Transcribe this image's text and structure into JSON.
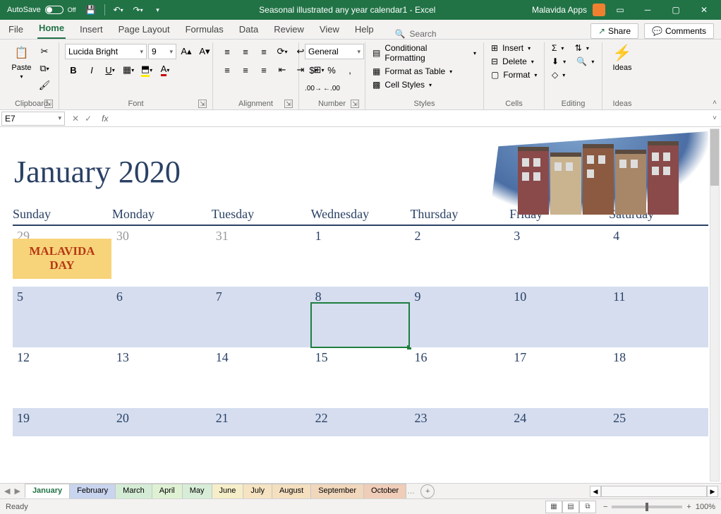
{
  "titlebar": {
    "autosave_label": "AutoSave",
    "autosave_state": "Off",
    "title": "Seasonal illustrated any year calendar1 - Excel",
    "apps_label": "Malavida Apps"
  },
  "tabs": {
    "file": "File",
    "home": "Home",
    "insert": "Insert",
    "pagelayout": "Page Layout",
    "formulas": "Formulas",
    "data": "Data",
    "review": "Review",
    "view": "View",
    "help": "Help",
    "search": "Search",
    "share": "Share",
    "comments": "Comments"
  },
  "ribbon": {
    "clipboard": {
      "paste": "Paste",
      "label": "Clipboard"
    },
    "font": {
      "name": "Lucida Bright",
      "size": "9",
      "label": "Font"
    },
    "alignment": {
      "label": "Alignment"
    },
    "number": {
      "format": "General",
      "label": "Number"
    },
    "styles": {
      "cond": "Conditional Formatting",
      "table": "Format as Table",
      "cell": "Cell Styles",
      "label": "Styles"
    },
    "cells": {
      "insert": "Insert",
      "delete": "Delete",
      "format": "Format",
      "label": "Cells"
    },
    "editing": {
      "label": "Editing"
    },
    "ideas": {
      "btn": "Ideas",
      "label": "Ideas"
    }
  },
  "formula_bar": {
    "cell": "E7",
    "formula": ""
  },
  "calendar": {
    "title": "January 2020",
    "days": [
      "Sunday",
      "Monday",
      "Tuesday",
      "Wednesday",
      "Thursday",
      "Friday",
      "Saturday"
    ],
    "weeks": [
      {
        "alt": false,
        "dim": true,
        "cells": [
          "29",
          "30",
          "31",
          "1",
          "2",
          "3",
          "4"
        ],
        "event": "MALAVIDA DAY"
      },
      {
        "alt": true,
        "cells": [
          "5",
          "6",
          "7",
          "8",
          "9",
          "10",
          "11"
        ],
        "selected_col": 3
      },
      {
        "alt": false,
        "cells": [
          "12",
          "13",
          "14",
          "15",
          "16",
          "17",
          "18"
        ]
      },
      {
        "alt": true,
        "cells": [
          "19",
          "20",
          "21",
          "22",
          "23",
          "24",
          "25"
        ]
      }
    ]
  },
  "sheets": [
    "January",
    "February",
    "March",
    "April",
    "May",
    "June",
    "July",
    "August",
    "September",
    "October"
  ],
  "status": {
    "ready": "Ready",
    "zoom": "100%"
  }
}
